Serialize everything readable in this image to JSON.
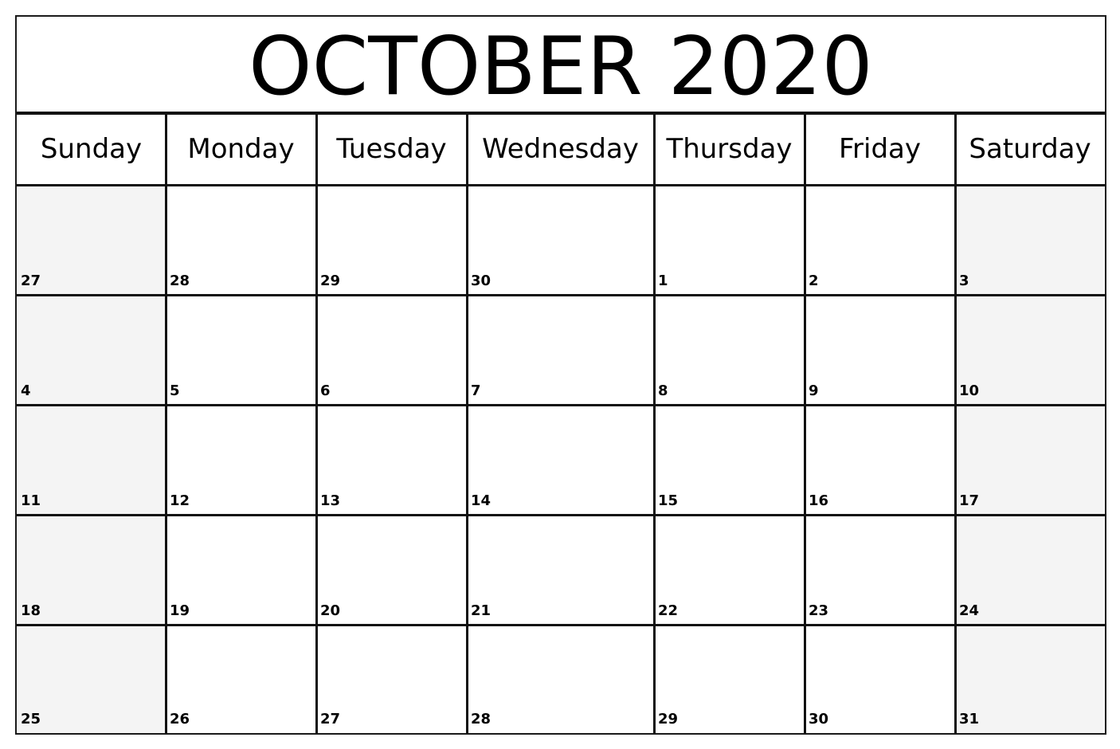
{
  "calendar": {
    "title": "OCTOBER 2020",
    "weekdays": [
      "Sunday",
      "Monday",
      "Tuesday",
      "Wednesday",
      "Thursday",
      "Friday",
      "Saturday"
    ],
    "weeks": [
      [
        "27",
        "28",
        "29",
        "30",
        "1",
        "2",
        "3"
      ],
      [
        "4",
        "5",
        "6",
        "7",
        "8",
        "9",
        "10"
      ],
      [
        "11",
        "12",
        "13",
        "14",
        "15",
        "16",
        "17"
      ],
      [
        "18",
        "19",
        "20",
        "21",
        "22",
        "23",
        "24"
      ],
      [
        "25",
        "26",
        "27",
        "28",
        "29",
        "30",
        "31"
      ]
    ],
    "weekend_shade_color": "#f4f4f4",
    "border_color": "#111111"
  }
}
